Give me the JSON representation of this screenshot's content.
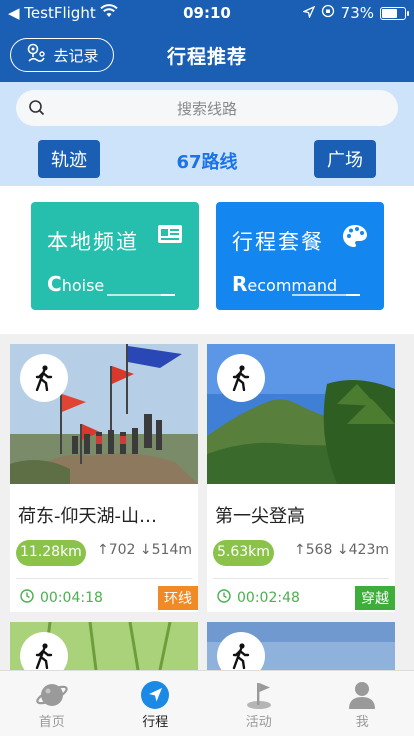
{
  "status_bar": {
    "back_app": "◀ TestFlight",
    "time": "09:10",
    "battery_text": "73%",
    "battery_level": 0.73
  },
  "header": {
    "goto_button": "去记录",
    "title": "行程推荐"
  },
  "search": {
    "placeholder": "搜索线路"
  },
  "filters": {
    "left_button": "轨迹",
    "count": "67路线",
    "right_button": "广场"
  },
  "channels": [
    {
      "title": "本地频道",
      "sub_initial": "C",
      "sub_rest": "hoise",
      "color": "#26bfae",
      "icon": "id-card-icon"
    },
    {
      "title": "行程套餐",
      "sub_initial": "R",
      "sub_rest": "ecommand",
      "color": "#1486f0",
      "icon": "palette-icon"
    }
  ],
  "routes": [
    {
      "name": "荷东-仰天湖-山…",
      "distance": "11.28km",
      "ascent": "702",
      "descent": "514m",
      "duration": "00:04:18",
      "badge": "环线",
      "badge_color": "#f08a24"
    },
    {
      "name": "第一尖登高",
      "distance": "5.63km",
      "ascent": "568",
      "descent": "423m",
      "duration": "00:02:48",
      "badge": "穿越",
      "badge_color": "#3dae3a"
    }
  ],
  "tabs": [
    {
      "label": "首页",
      "icon": "planet-icon",
      "active": false
    },
    {
      "label": "行程",
      "icon": "compass-icon",
      "active": true
    },
    {
      "label": "活动",
      "icon": "flag-icon",
      "active": false
    },
    {
      "label": "我",
      "icon": "person-icon",
      "active": false
    }
  ]
}
